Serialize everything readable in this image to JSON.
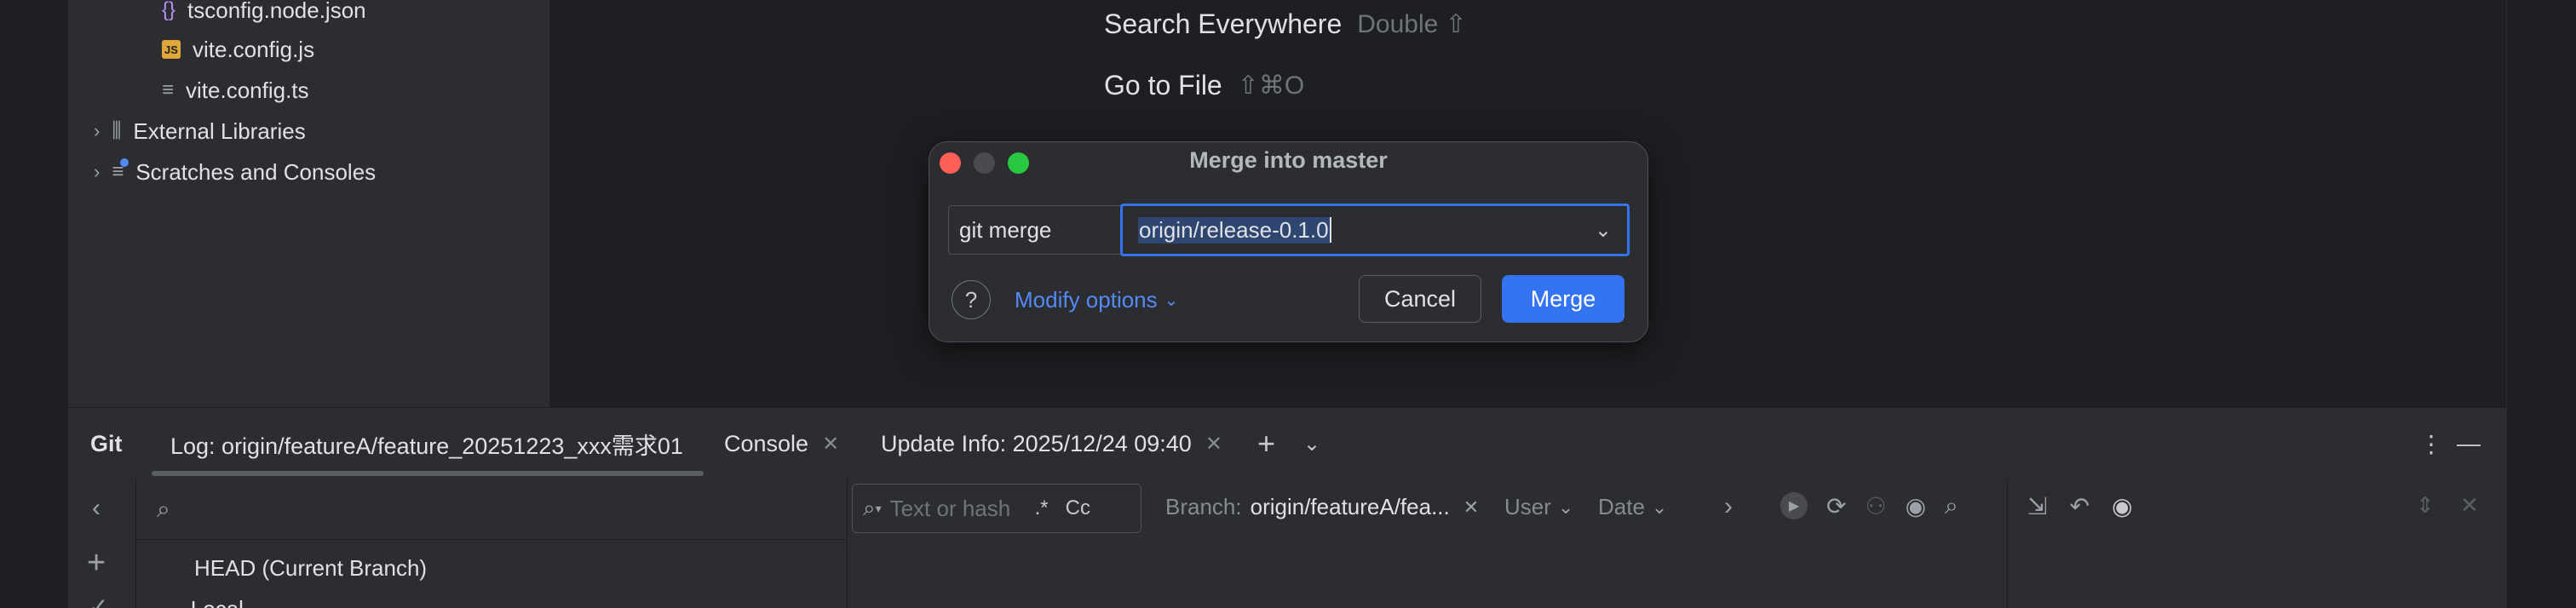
{
  "project_tree": {
    "items": [
      {
        "label": "tsconfig.node.json",
        "icon": "json-braces-icon"
      },
      {
        "label": "vite.config.js",
        "icon": "js-file-icon"
      },
      {
        "label": "vite.config.ts",
        "icon": "text-file-icon"
      },
      {
        "label": "External Libraries",
        "icon": "library-icon"
      },
      {
        "label": "Scratches and Consoles",
        "icon": "scratches-icon"
      }
    ]
  },
  "editor_hints": {
    "search_everywhere": {
      "label": "Search Everywhere",
      "shortcut": "Double ⇧"
    },
    "go_to_file": {
      "label": "Go to File",
      "shortcut": "⇧⌘O"
    }
  },
  "dialog": {
    "title": "Merge into master",
    "command_label": "git merge",
    "branch_value": "origin/release-0.1.0",
    "modify_options": "Modify options",
    "cancel": "Cancel",
    "merge": "Merge",
    "help": "?"
  },
  "bottom_panel": {
    "title": "Git",
    "tabs": [
      {
        "label": "Log: origin/featureA/feature_20251223_xxx需求01"
      },
      {
        "label": "Console"
      },
      {
        "label": "Update Info: 2025/12/24 09:40"
      }
    ]
  },
  "git_log": {
    "search_placeholder": "Text or hash",
    "regex_toggle": ".*",
    "case_toggle": "Cc",
    "branch_filter_label": "Branch:",
    "branch_filter_value": "origin/featureA/fea...",
    "user_filter": "User",
    "date_filter": "Date",
    "branches": [
      {
        "label": "HEAD (Current Branch)"
      },
      {
        "label": "Local"
      }
    ]
  },
  "colors": {
    "background": "#1e1f22",
    "panel": "#2b2d30",
    "accent": "#3574f0",
    "link": "#548af7",
    "close": "#ff5f57",
    "minimize": "#4a4b4f",
    "zoom": "#28c840"
  }
}
